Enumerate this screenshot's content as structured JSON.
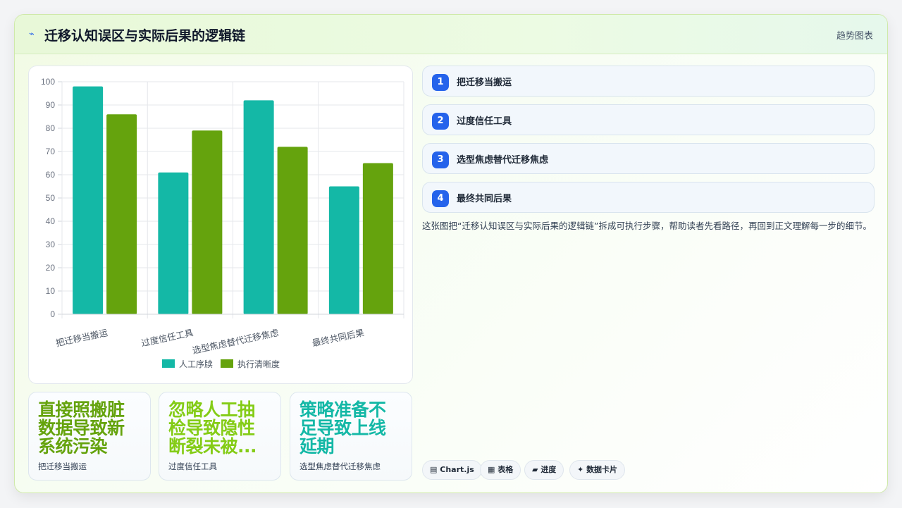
{
  "header": {
    "icon": "trend-icon",
    "title": "迁移认知误区与实际后果的逻辑链",
    "link_label": "趋势图表"
  },
  "colors": {
    "series1": "#14b8a6",
    "series2": "#65a30d",
    "step_badge": "#2563eb"
  },
  "chart_data": {
    "type": "bar",
    "categories": [
      "把迁移当搬运",
      "过度信任工具",
      "选型焦虑替代迁移焦虑",
      "最终共同后果"
    ],
    "series": [
      {
        "name": "人工序牍",
        "values": [
          98,
          61,
          92,
          55
        ]
      },
      {
        "name": "执行清晰度",
        "values": [
          86,
          79,
          72,
          65
        ]
      }
    ],
    "ylim": [
      0,
      100
    ],
    "yticks": [
      0,
      10,
      20,
      30,
      40,
      50,
      60,
      70,
      80,
      90,
      100
    ],
    "legend": "bottom",
    "grid": true
  },
  "stats": [
    {
      "headline": "直接照搬脏数据导致新系统污染",
      "display": "直接照搬脏\n数据导致新\n系统污染",
      "caption": "把迁移当搬运",
      "color": "#65a30d"
    },
    {
      "headline": "忽略人工抽检导致隐性断裂未被...",
      "display": "忽略人工抽\n检导致隐性\n断裂未被...",
      "caption": "过度信任工具",
      "color": "#84cc16"
    },
    {
      "headline": "策略准备不足导致上线延期",
      "display": "策略准备不\n足导致上线\n延期",
      "caption": "选型焦虑替代迁移焦虑",
      "color": "#14b8a6"
    }
  ],
  "steps": [
    {
      "num": "1",
      "label": "把迁移当搬运"
    },
    {
      "num": "2",
      "label": "过度信任工具"
    },
    {
      "num": "3",
      "label": "选型焦虑替代迁移焦虑"
    },
    {
      "num": "4",
      "label": "最终共同后果"
    }
  ],
  "description": "这张图把“迁移认知误区与实际后果的逻辑链”拆成可执行步骤，帮助读者先看路径，再回到正文理解每一步的细节。",
  "tags": [
    {
      "icon": "chart-icon",
      "glyph": "▤",
      "label": "Chart.js"
    },
    {
      "icon": "table-icon",
      "glyph": "▦",
      "label": "表格"
    },
    {
      "icon": "progress-icon",
      "glyph": "▰",
      "label": "进度"
    },
    {
      "icon": "sparkle-icon",
      "glyph": "✦",
      "label": "数据卡片"
    }
  ]
}
